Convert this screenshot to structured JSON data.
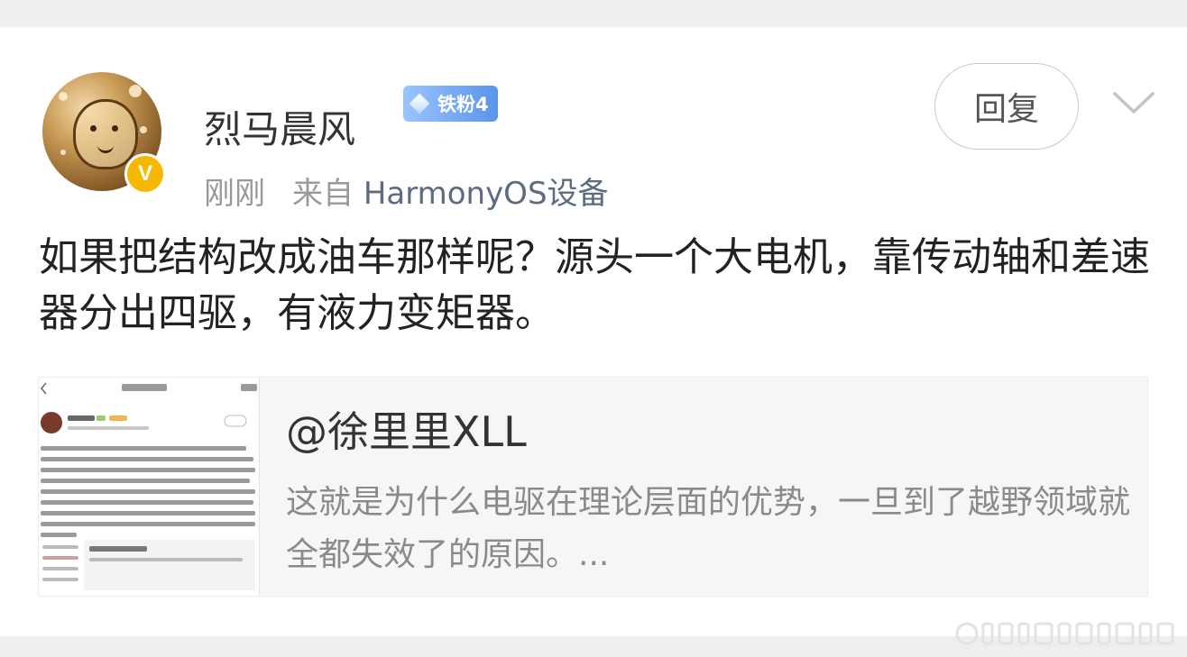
{
  "post": {
    "username": "烈马晨风",
    "fan_badge": "铁粉4",
    "verified_mark": "V",
    "time": "刚刚",
    "source_prefix": "来自",
    "source_device": "HarmonyOS设备",
    "reply_label": "回复",
    "content": "如果把结构改成油车那样呢？源头一个大电机，靠传动轴和差速器分出四驱，有液力变矩器。"
  },
  "quoted": {
    "author": "@徐里里XLL",
    "text": "这就是为什么电驱在理论层面的优势，一旦到了越野领域就全都失效了的原因。..."
  },
  "icons": {
    "avatar": "avatar-image",
    "verified": "verified-v-icon",
    "fan": "diamond-icon",
    "more": "chevron-down-icon",
    "thumbnail": "comment-screenshot-thumbnail",
    "watermark": "weibo-watermark"
  },
  "colors": {
    "verified_badge": "#f6b800",
    "fan_badge": "#5a94ea",
    "device_link": "#5b6c80",
    "background": "#eeeeee"
  }
}
